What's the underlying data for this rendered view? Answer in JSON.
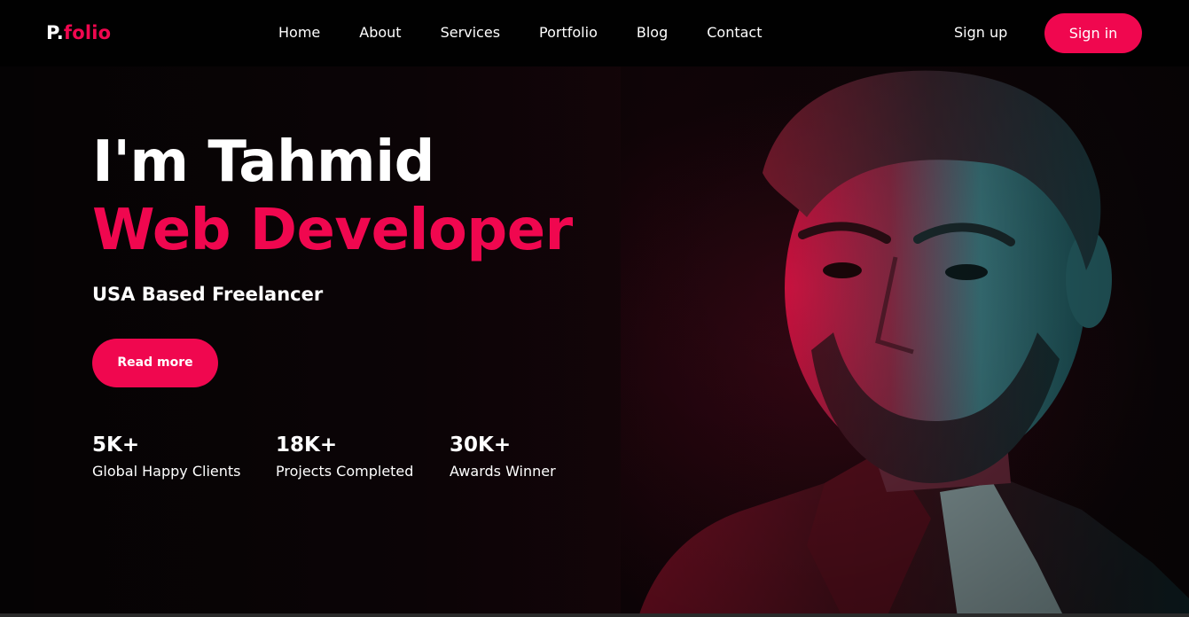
{
  "logo": {
    "prefix": "P.",
    "name": "folio"
  },
  "nav": {
    "items": [
      {
        "label": "Home"
      },
      {
        "label": "About"
      },
      {
        "label": "Services"
      },
      {
        "label": "Portfolio"
      },
      {
        "label": "Blog"
      },
      {
        "label": "Contact"
      }
    ],
    "signup_label": "Sign up",
    "signin_label": "Sign in"
  },
  "hero": {
    "title": "I'm Tahmid",
    "role": "Web Developer",
    "subtitle": "USA Based Freelancer",
    "button_label": "Read more"
  },
  "stats": [
    {
      "value": "5K+",
      "label": "Global Happy Clients"
    },
    {
      "value": "18K+",
      "label": "Projects Completed"
    },
    {
      "value": "30K+",
      "label": "Awards Winner"
    }
  ],
  "colors": {
    "accent": "#f0074f",
    "navbar_bg": "#010101",
    "page_bg": "#060304",
    "text": "#ffffff"
  },
  "icons": {
    "portrait": "man-portrait-image"
  }
}
